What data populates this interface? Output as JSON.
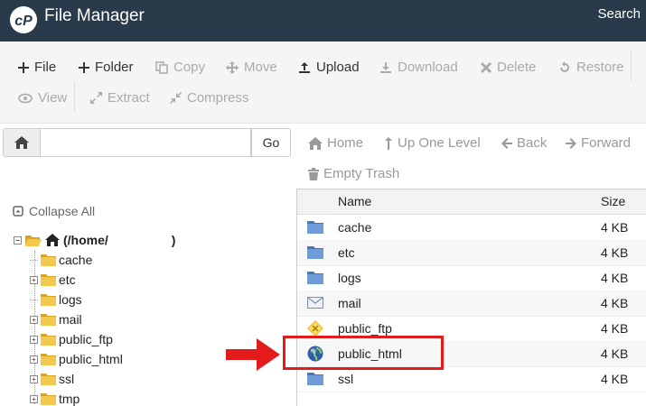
{
  "header": {
    "title": "File Manager",
    "search_label": "Search"
  },
  "toolbar": {
    "file": "File",
    "folder": "Folder",
    "copy": "Copy",
    "move": "Move",
    "upload": "Upload",
    "download": "Download",
    "delete": "Delete",
    "restore": "Restore",
    "view": "View",
    "extract": "Extract",
    "compress": "Compress"
  },
  "path_bar": {
    "value": "",
    "go_label": "Go"
  },
  "nav": {
    "home": "Home",
    "up": "Up One Level",
    "back": "Back",
    "forward": "Forward",
    "empty_trash": "Empty Trash"
  },
  "tree": {
    "collapse_label": "Collapse All",
    "root_label": "(/home/",
    "root_suffix": ")",
    "items": [
      {
        "label": "cache",
        "expandable": false
      },
      {
        "label": "etc",
        "expandable": true
      },
      {
        "label": "logs",
        "expandable": false
      },
      {
        "label": "mail",
        "expandable": true
      },
      {
        "label": "public_ftp",
        "expandable": true
      },
      {
        "label": "public_html",
        "expandable": true
      },
      {
        "label": "ssl",
        "expandable": true
      },
      {
        "label": "tmp",
        "expandable": true
      }
    ]
  },
  "files": {
    "col_name": "Name",
    "col_size": "Size",
    "rows": [
      {
        "name": "cache",
        "size": "4 KB",
        "icon": "folder-icon"
      },
      {
        "name": "etc",
        "size": "4 KB",
        "icon": "folder-icon"
      },
      {
        "name": "logs",
        "size": "4 KB",
        "icon": "folder-icon"
      },
      {
        "name": "mail",
        "size": "4 KB",
        "icon": "mail-folder-icon"
      },
      {
        "name": "public_ftp",
        "size": "4 KB",
        "icon": "ftp-folder-icon"
      },
      {
        "name": "public_html",
        "size": "4 KB",
        "icon": "globe-folder-icon"
      },
      {
        "name": "ssl",
        "size": "4 KB",
        "icon": "folder-icon"
      }
    ]
  },
  "colors": {
    "header_bg": "#293a4a",
    "annotation_red": "#e31b1b",
    "folder_blue": "#5b87c5",
    "folder_yellow": "#f2c94c"
  }
}
